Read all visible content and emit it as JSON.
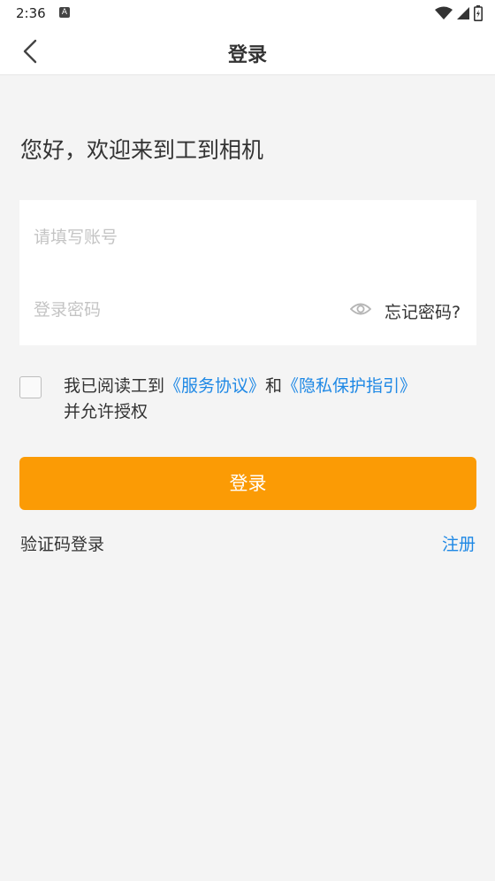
{
  "status_bar": {
    "time": "2:36",
    "notification_badge": "A",
    "icons": [
      "wifi-icon",
      "signal-icon",
      "battery-icon"
    ]
  },
  "header": {
    "back_icon": "chevron-left-icon",
    "title": "登录"
  },
  "welcome_text": "您好，欢迎来到工到相机",
  "form": {
    "account_placeholder": "请填写账号",
    "account_value": "",
    "password_placeholder": "登录密码",
    "password_value": "",
    "eye_icon": "eye-icon",
    "forgot_password": "忘记密码?"
  },
  "agreement": {
    "checked": false,
    "prefix": "我已阅读工到",
    "service_link": "《服务协议》",
    "and": "和",
    "privacy_link": "《隐私保护指引》",
    "suffix": "并允许授权"
  },
  "login_button": "登录",
  "sms_login": "验证码登录",
  "register": "注册",
  "colors": {
    "accent": "#fb9b05",
    "link": "#1e88e5",
    "background": "#f4f4f4",
    "surface": "#ffffff",
    "text": "#333333",
    "placeholder": "#c4c4c4"
  }
}
